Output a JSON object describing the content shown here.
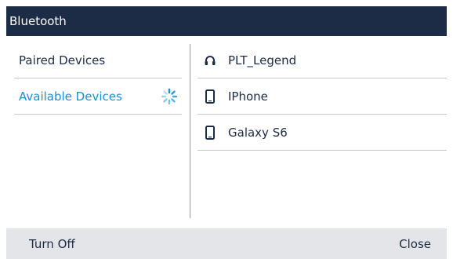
{
  "title": "Bluetooth",
  "left_menu": [
    {
      "label": "Paired Devices",
      "active": false
    },
    {
      "label": "Available Devices",
      "active": true,
      "status_icon": "spinner-icon"
    }
  ],
  "devices": [
    {
      "name": "PLT_Legend",
      "icon": "headset-icon"
    },
    {
      "name": "IPhone",
      "icon": "phone-icon"
    },
    {
      "name": "Galaxy S6",
      "icon": "phone-icon"
    }
  ],
  "softkeys": {
    "left": "Turn Off",
    "right": "Close"
  },
  "colors": {
    "titlebar": "#1c2b46",
    "accent": "#1a8fd8",
    "softkey_bar": "#e3e5e8"
  }
}
